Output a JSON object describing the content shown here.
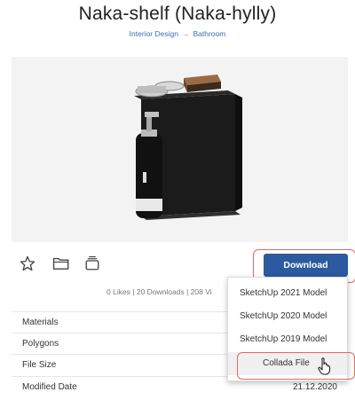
{
  "header": {
    "title": "Naka-shelf (Naka-hylly)",
    "breadcrumb": [
      "Interior Design",
      "Bathroom"
    ],
    "breadcrumb_separator": "→"
  },
  "preview": {
    "image_alt": "3D model preview of a black wall shelf with soap dispenser, bottle and wooden brush"
  },
  "actions": {
    "icons": [
      "star-icon",
      "folder-icon",
      "collection-icon"
    ],
    "download_label": "Download"
  },
  "stats": {
    "text": "0 Likes | 20 Downloads | 208 Vi"
  },
  "details": [
    {
      "label": "Materials",
      "value": ""
    },
    {
      "label": "Polygons",
      "value": ""
    },
    {
      "label": "File Size",
      "value": ""
    },
    {
      "label": "Modified Date",
      "value": "21.12.2020"
    }
  ],
  "download_menu": {
    "options": [
      "SketchUp 2021 Model",
      "SketchUp 2020 Model",
      "SketchUp 2019 Model",
      "Collada File"
    ],
    "hovered": "Collada File"
  },
  "colors": {
    "accent": "#2b5aa0",
    "highlight": "#e06a6a",
    "link": "#3a6fb5"
  }
}
